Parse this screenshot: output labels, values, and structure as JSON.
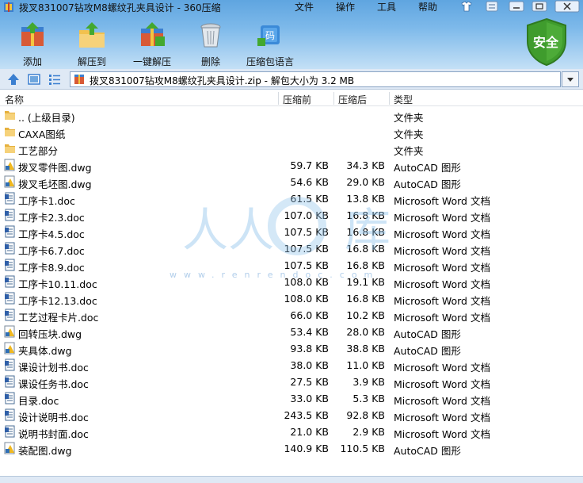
{
  "window": {
    "title": "拨叉831007钻攻M8螺纹孔夹具设计 - 360压缩"
  },
  "menu": [
    "文件",
    "操作",
    "工具",
    "帮助"
  ],
  "toolbar": {
    "buttons": [
      {
        "label": "添加",
        "icon": "add-icon"
      },
      {
        "label": "解压到",
        "icon": "extract-to-icon"
      },
      {
        "label": "一键解压",
        "icon": "one-click-extract-icon"
      },
      {
        "label": "删除",
        "icon": "delete-icon"
      },
      {
        "label": "压缩包语言",
        "icon": "archive-language-icon"
      }
    ],
    "security_label": "安全"
  },
  "address": {
    "path": "拨叉831007钻攻M8螺纹孔夹具设计.zip - 解包大小为 3.2 MB"
  },
  "columns": {
    "name": "名称",
    "size": "压缩前",
    "compressed": "压缩后",
    "type": "类型"
  },
  "files": [
    {
      "name": ".. (上级目录)",
      "size": "",
      "compressed": "",
      "type": "文件夹",
      "kind": "folder"
    },
    {
      "name": "CAXA图纸",
      "size": "",
      "compressed": "",
      "type": "文件夹",
      "kind": "folder"
    },
    {
      "name": "工艺部分",
      "size": "",
      "compressed": "",
      "type": "文件夹",
      "kind": "folder"
    },
    {
      "name": "拨叉零件图.dwg",
      "size": "59.7 KB",
      "compressed": "34.3 KB",
      "type": "AutoCAD 图形",
      "kind": "dwg"
    },
    {
      "name": "拨叉毛坯图.dwg",
      "size": "54.6 KB",
      "compressed": "29.0 KB",
      "type": "AutoCAD 图形",
      "kind": "dwg"
    },
    {
      "name": "工序卡1.doc",
      "size": "61.5 KB",
      "compressed": "13.8 KB",
      "type": "Microsoft Word 文档",
      "kind": "doc"
    },
    {
      "name": "工序卡2.3.doc",
      "size": "107.0 KB",
      "compressed": "16.8 KB",
      "type": "Microsoft Word 文档",
      "kind": "doc"
    },
    {
      "name": "工序卡4.5.doc",
      "size": "107.5 KB",
      "compressed": "16.8 KB",
      "type": "Microsoft Word 文档",
      "kind": "doc"
    },
    {
      "name": "工序卡6.7.doc",
      "size": "107.5 KB",
      "compressed": "16.8 KB",
      "type": "Microsoft Word 文档",
      "kind": "doc"
    },
    {
      "name": "工序卡8.9.doc",
      "size": "107.5 KB",
      "compressed": "16.8 KB",
      "type": "Microsoft Word 文档",
      "kind": "doc"
    },
    {
      "name": "工序卡10.11.doc",
      "size": "108.0 KB",
      "compressed": "19.1 KB",
      "type": "Microsoft Word 文档",
      "kind": "doc"
    },
    {
      "name": "工序卡12.13.doc",
      "size": "108.0 KB",
      "compressed": "16.8 KB",
      "type": "Microsoft Word 文档",
      "kind": "doc"
    },
    {
      "name": "工艺过程卡片.doc",
      "size": "66.0 KB",
      "compressed": "10.2 KB",
      "type": "Microsoft Word 文档",
      "kind": "doc"
    },
    {
      "name": "回转压块.dwg",
      "size": "53.4 KB",
      "compressed": "28.0 KB",
      "type": "AutoCAD 图形",
      "kind": "dwg"
    },
    {
      "name": "夹具体.dwg",
      "size": "93.8 KB",
      "compressed": "38.8 KB",
      "type": "AutoCAD 图形",
      "kind": "dwg"
    },
    {
      "name": "课设计划书.doc",
      "size": "38.0 KB",
      "compressed": "11.0 KB",
      "type": "Microsoft Word 文档",
      "kind": "doc"
    },
    {
      "name": "课设任务书.doc",
      "size": "27.5 KB",
      "compressed": "3.9 KB",
      "type": "Microsoft Word 文档",
      "kind": "doc"
    },
    {
      "name": "目录.doc",
      "size": "33.0 KB",
      "compressed": "5.3 KB",
      "type": "Microsoft Word 文档",
      "kind": "doc"
    },
    {
      "name": "设计说明书.doc",
      "size": "243.5 KB",
      "compressed": "92.8 KB",
      "type": "Microsoft Word 文档",
      "kind": "doc"
    },
    {
      "name": "说明书封面.doc",
      "size": "21.0 KB",
      "compressed": "2.9 KB",
      "type": "Microsoft Word 文档",
      "kind": "doc"
    },
    {
      "name": "装配图.dwg",
      "size": "140.9 KB",
      "compressed": "110.5 KB",
      "type": "AutoCAD 图形",
      "kind": "dwg"
    }
  ],
  "watermark": {
    "text": "人人文库",
    "url": "www.renrendoc.com"
  },
  "colors": {
    "toolbar_top": "#5fa5e0",
    "toolbar_bottom": "#c4e0f6",
    "shield_green": "#3f9c2d",
    "folder_yellow": "#f2c14e"
  }
}
